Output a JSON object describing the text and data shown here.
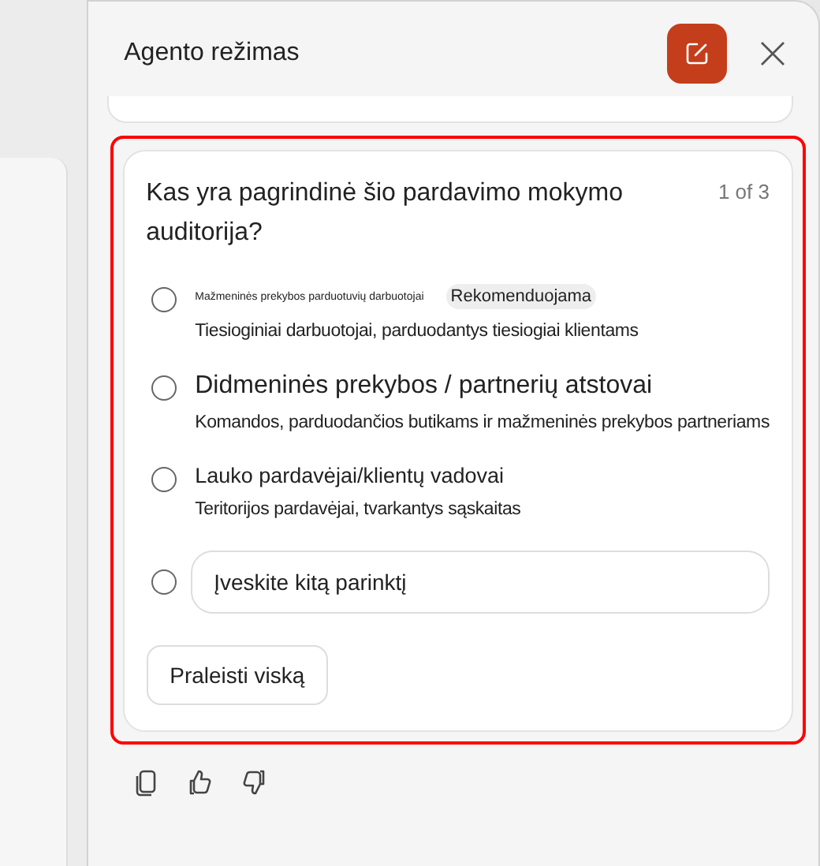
{
  "panel": {
    "title": "Agento režimas"
  },
  "question": {
    "text": "Kas yra pagrindinė šio pardavimo mokymo auditorija?",
    "counter": "1 of 3",
    "options": [
      {
        "kind": "small_option",
        "label": "Mažmeninės prekybos parduotuvių darbuotojai",
        "badge": "Rekomenduojama",
        "description": "Tiesioginiai darbuotojai, parduodantys tiesiogiai klientams",
        "selected": false
      },
      {
        "kind": "large_option",
        "label": "Didmeninės prekybos / partnerių atstovai",
        "description": "Komandos, parduodančios butikams ir mažmeninės prekybos partneriams",
        "selected": false
      },
      {
        "kind": "option",
        "label": "Lauko pardavėjai/klientų vadovai",
        "description": "Teritorijos pardavėjai, tvarkantys sąskaitas",
        "selected": false
      },
      {
        "kind": "custom",
        "placeholder": "Įveskite kitą parinktį",
        "selected": false
      }
    ],
    "skip_button": "Praleisti viską"
  }
}
